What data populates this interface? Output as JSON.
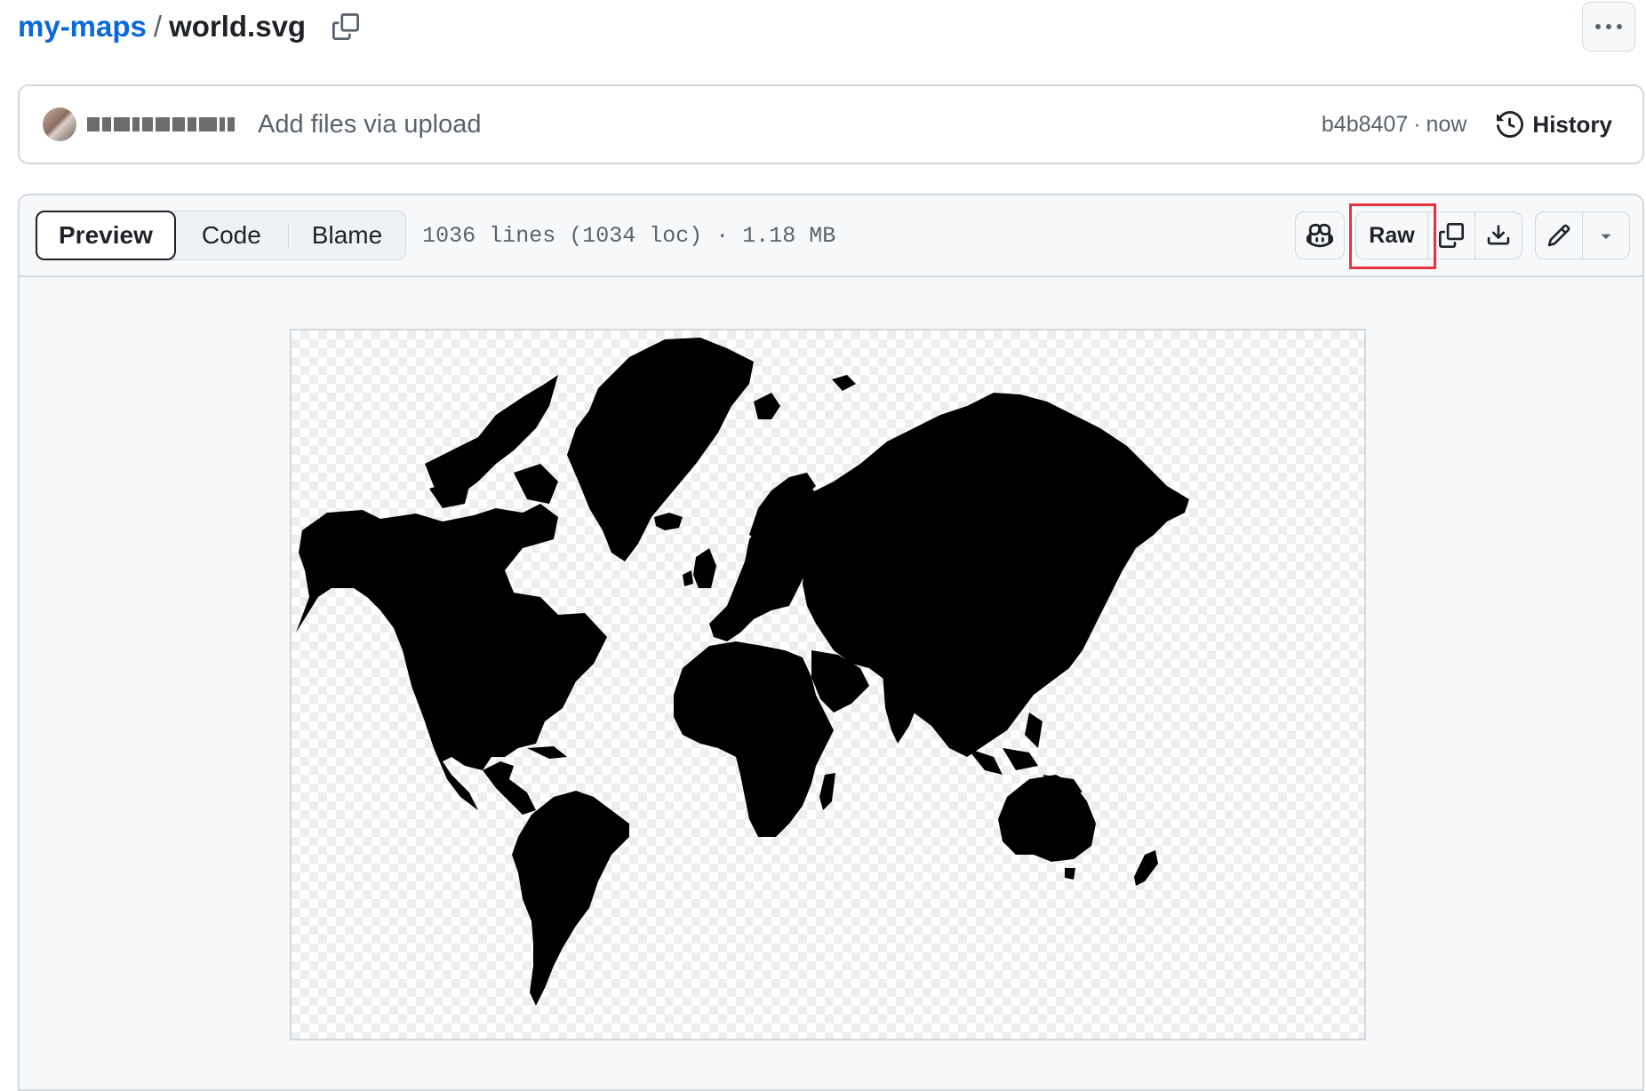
{
  "breadcrumb": {
    "repo": "my-maps",
    "separator": "/",
    "file": "world.svg"
  },
  "commit": {
    "message": "Add files via upload",
    "hash": "b4b8407",
    "dot": "·",
    "time": "now",
    "history_label": "History"
  },
  "file": {
    "tabs": [
      {
        "label": "Preview",
        "active": true
      },
      {
        "label": "Code",
        "active": false
      },
      {
        "label": "Blame",
        "active": false
      }
    ],
    "meta": "1036 lines (1034 loc) · 1.18 MB",
    "raw_label": "Raw"
  },
  "icons": [
    "copy-icon",
    "kebab-icon",
    "history-icon",
    "copilot-icon",
    "download-icon",
    "pencil-icon",
    "triangle-down-icon"
  ],
  "colors": {
    "link": "#0969da",
    "border": "#d1d9e0",
    "highlight": "#e5343d",
    "land": "#000000"
  }
}
